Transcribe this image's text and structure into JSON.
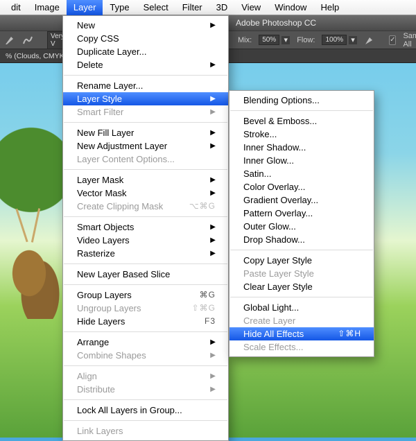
{
  "menubar": {
    "items": [
      "dit",
      "Image",
      "Layer",
      "Type",
      "Select",
      "Filter",
      "3D",
      "View",
      "Window",
      "Help"
    ],
    "open_index": 2
  },
  "app": {
    "title": "Adobe Photoshop CC",
    "doc_tab": "% (Clouds, CMYK",
    "toolbar": {
      "brush_label": "Very V",
      "mix_label": "Mix:",
      "mix_val": "50%",
      "flow_label": "Flow:",
      "flow_val": "100%",
      "sample_label": "Sample All"
    }
  },
  "layer_menu": {
    "g0": [
      {
        "label": "New",
        "arrow": true
      },
      {
        "label": "Copy CSS"
      },
      {
        "label": "Duplicate Layer..."
      },
      {
        "label": "Delete",
        "arrow": true
      }
    ],
    "g1": [
      {
        "label": "Rename Layer..."
      },
      {
        "label": "Layer Style",
        "arrow": true,
        "hl": true
      },
      {
        "label": "Smart Filter",
        "arrow": true,
        "disabled": true
      }
    ],
    "g2": [
      {
        "label": "New Fill Layer",
        "arrow": true
      },
      {
        "label": "New Adjustment Layer",
        "arrow": true
      },
      {
        "label": "Layer Content Options...",
        "disabled": true
      }
    ],
    "g3": [
      {
        "label": "Layer Mask",
        "arrow": true
      },
      {
        "label": "Vector Mask",
        "arrow": true
      },
      {
        "label": "Create Clipping Mask",
        "sc": "⌥⌘G",
        "disabled": true
      }
    ],
    "g4": [
      {
        "label": "Smart Objects",
        "arrow": true
      },
      {
        "label": "Video Layers",
        "arrow": true
      },
      {
        "label": "Rasterize",
        "arrow": true
      }
    ],
    "g5": [
      {
        "label": "New Layer Based Slice"
      }
    ],
    "g6": [
      {
        "label": "Group Layers",
        "sc": "⌘G"
      },
      {
        "label": "Ungroup Layers",
        "sc": "⇧⌘G",
        "disabled": true
      },
      {
        "label": "Hide Layers",
        "sc": "F3"
      }
    ],
    "g7": [
      {
        "label": "Arrange",
        "arrow": true
      },
      {
        "label": "Combine Shapes",
        "arrow": true,
        "disabled": true
      }
    ],
    "g8": [
      {
        "label": "Align",
        "arrow": true,
        "disabled": true
      },
      {
        "label": "Distribute",
        "arrow": true,
        "disabled": true
      }
    ],
    "g9": [
      {
        "label": "Lock All Layers in Group..."
      }
    ],
    "g10": [
      {
        "label": "Link Layers",
        "disabled": true
      }
    ]
  },
  "layer_style_menu": {
    "g0": [
      {
        "label": "Blending Options..."
      }
    ],
    "g1": [
      {
        "label": "Bevel & Emboss..."
      },
      {
        "label": "Stroke..."
      },
      {
        "label": "Inner Shadow..."
      },
      {
        "label": "Inner Glow..."
      },
      {
        "label": "Satin..."
      },
      {
        "label": "Color Overlay..."
      },
      {
        "label": "Gradient Overlay..."
      },
      {
        "label": "Pattern Overlay..."
      },
      {
        "label": "Outer Glow..."
      },
      {
        "label": "Drop Shadow..."
      }
    ],
    "g2": [
      {
        "label": "Copy Layer Style"
      },
      {
        "label": "Paste Layer Style",
        "disabled": true
      },
      {
        "label": "Clear Layer Style"
      }
    ],
    "g3": [
      {
        "label": "Global Light..."
      },
      {
        "label": "Create Layer",
        "disabled": true
      },
      {
        "label": "Hide All Effects",
        "sc": "⇧⌘H",
        "hl": true
      },
      {
        "label": "Scale Effects...",
        "disabled": true
      }
    ]
  }
}
